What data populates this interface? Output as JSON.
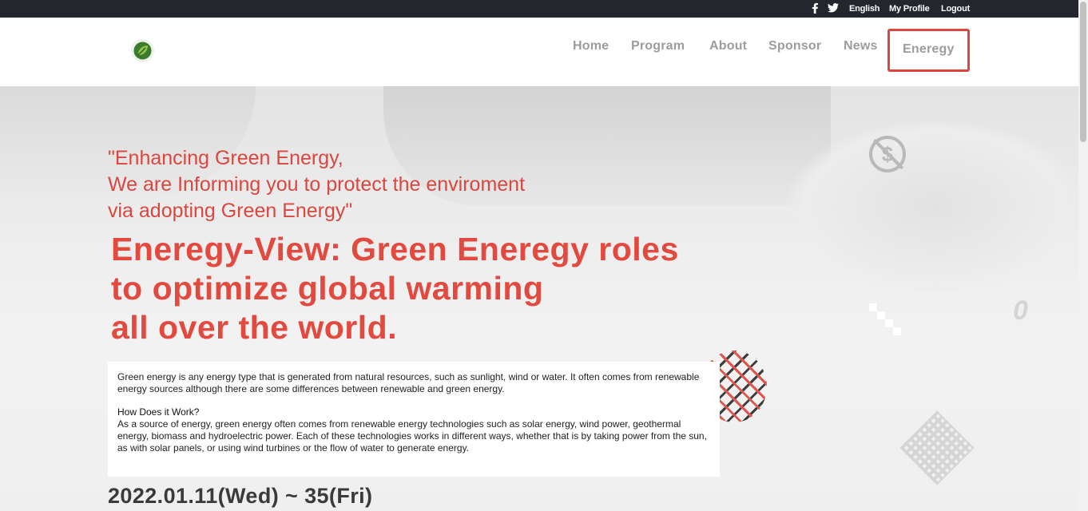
{
  "topbar": {
    "facebook_icon": "facebook-icon",
    "twitter_icon": "twitter-icon",
    "language": "English",
    "my_profile": "My Profile",
    "logout": "Logout"
  },
  "nav": {
    "home": "Home",
    "program": "Program",
    "about": "About",
    "sponsor": "Sponsor",
    "news": "News",
    "energy": "Eneregy"
  },
  "hero": {
    "quote_lines": [
      "\"Enhancing Green Energy,",
      "We are Informing you to protect the enviroment",
      "via adopting Green Energy\""
    ],
    "headline_lines": [
      "Eneregy-View: Green Eneregy roles",
      "to optimize global warming",
      "all over the world."
    ],
    "info": {
      "intro": "Green energy is any energy type that is generated from natural resources, such as sunlight, wind or water. It often comes from renewable energy sources although there are some differences between renewable and green energy.",
      "subheading": "How Does it Work?",
      "body": "As a source of energy, green energy often comes from renewable energy technologies such as solar energy, wind power, geothermal energy, biomass and hydroelectric power. Each of these technologies works in different ways, whether that is by taking power from the sun, as with solar panels, or using wind turbines or the flow of water to generate energy."
    },
    "date": "2022.01.11(Wed) ~ 35(Fri)"
  },
  "colors": {
    "accent": "#d9473f",
    "topbar_bg": "#23262d",
    "nav_text": "#9c9c9c"
  }
}
